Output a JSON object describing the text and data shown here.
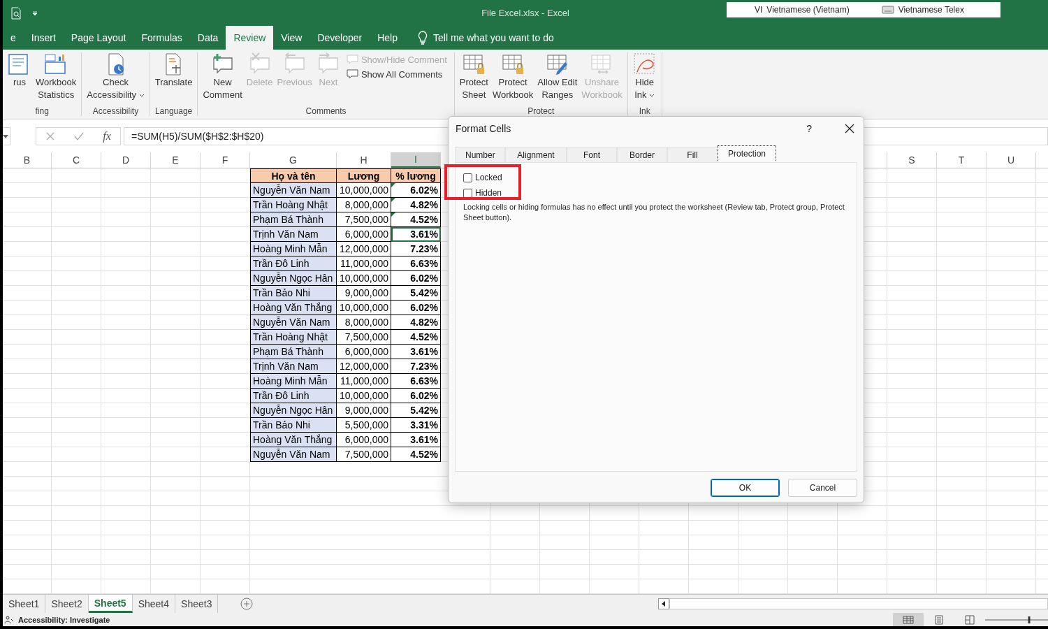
{
  "window": {
    "title": "File Excel.xlsx  -  Excel"
  },
  "language_bar": {
    "code": "VI",
    "language": "Vietnamese (Vietnam)",
    "keyboard": "Vietnamese Telex"
  },
  "tabs": [
    {
      "label": "e",
      "selected": false
    },
    {
      "label": "Insert",
      "selected": false
    },
    {
      "label": "Page Layout",
      "selected": false
    },
    {
      "label": "Formulas",
      "selected": false
    },
    {
      "label": "Data",
      "selected": false
    },
    {
      "label": "Review",
      "selected": true
    },
    {
      "label": "View",
      "selected": false
    },
    {
      "label": "Developer",
      "selected": false
    },
    {
      "label": "Help",
      "selected": false
    }
  ],
  "tell_me": {
    "placeholder": "Tell me what you want to do"
  },
  "ribbon": {
    "groups": [
      {
        "label": "fing",
        "buttons": [
          {
            "kind": "large",
            "lines": [
              "rus"
            ],
            "disabled": false,
            "dropdown": false
          },
          {
            "kind": "large",
            "lines": [
              "Workbook",
              "Statistics"
            ],
            "disabled": false,
            "dropdown": false
          }
        ]
      },
      {
        "label": "Accessibility",
        "buttons": [
          {
            "kind": "large",
            "lines": [
              "Check",
              "Accessibility"
            ],
            "disabled": false,
            "dropdown": true
          }
        ]
      },
      {
        "label": "Language",
        "buttons": [
          {
            "kind": "large",
            "lines": [
              "Translate"
            ],
            "disabled": false,
            "dropdown": false
          }
        ]
      },
      {
        "label": "Comments",
        "buttons": [
          {
            "kind": "large",
            "lines": [
              "New",
              "Comment"
            ],
            "disabled": false,
            "dropdown": false
          },
          {
            "kind": "large",
            "lines": [
              "Delete"
            ],
            "disabled": true,
            "dropdown": false
          },
          {
            "kind": "large",
            "lines": [
              "Previous"
            ],
            "disabled": true,
            "dropdown": false
          },
          {
            "kind": "large",
            "lines": [
              "Next"
            ],
            "disabled": true,
            "dropdown": false
          },
          {
            "kind": "small",
            "lines": [
              "Show/Hide Comment"
            ],
            "disabled": true
          },
          {
            "kind": "small",
            "lines": [
              "Show All Comments"
            ],
            "disabled": false
          }
        ]
      },
      {
        "label": "Protect",
        "buttons": [
          {
            "kind": "large",
            "lines": [
              "Protect",
              "Sheet"
            ],
            "disabled": false,
            "dropdown": false
          },
          {
            "kind": "large",
            "lines": [
              "Protect",
              "Workbook"
            ],
            "disabled": false,
            "dropdown": false
          },
          {
            "kind": "large",
            "lines": [
              "Allow Edit",
              "Ranges"
            ],
            "disabled": false,
            "dropdown": false
          },
          {
            "kind": "large",
            "lines": [
              "Unshare",
              "Workbook"
            ],
            "disabled": true,
            "dropdown": false
          }
        ]
      },
      {
        "label": "Ink",
        "buttons": [
          {
            "kind": "large",
            "lines": [
              "Hide",
              "Ink"
            ],
            "disabled": false,
            "dropdown": true
          }
        ]
      }
    ]
  },
  "formula_bar": {
    "function_label": "fx",
    "formula": "=SUM(H5)/SUM($H$2:$H$20)"
  },
  "columns": [
    {
      "letter": "B",
      "selected": false
    },
    {
      "letter": "C",
      "selected": false
    },
    {
      "letter": "D",
      "selected": false
    },
    {
      "letter": "E",
      "selected": false
    },
    {
      "letter": "F",
      "selected": false
    },
    {
      "letter": "G",
      "selected": false
    },
    {
      "letter": "H",
      "selected": false
    },
    {
      "letter": "I",
      "selected": true
    },
    {
      "letter": "S",
      "selected": false
    },
    {
      "letter": "T",
      "selected": false
    },
    {
      "letter": "U",
      "selected": false
    }
  ],
  "table": {
    "columns": [
      "Họ và tên",
      "Lương",
      "% lương"
    ],
    "rows": [
      {
        "name": "Nguyễn Văn Nam",
        "salary": "10,000,000",
        "percent": "6.02%",
        "flagged": true,
        "selected": false
      },
      {
        "name": "Trần Hoàng Nhật",
        "salary": "8,000,000",
        "percent": "4.82%",
        "flagged": true,
        "selected": false
      },
      {
        "name": "Phạm Bá Thành",
        "salary": "7,500,000",
        "percent": "4.52%",
        "flagged": true,
        "selected": false
      },
      {
        "name": "Trịnh Văn Nam",
        "salary": "6,000,000",
        "percent": "3.61%",
        "flagged": false,
        "selected": true
      },
      {
        "name": "Hoàng Minh Mẫn",
        "salary": "12,000,000",
        "percent": "7.23%",
        "flagged": false,
        "selected": false
      },
      {
        "name": "Trần Đô Linh",
        "salary": "11,000,000",
        "percent": "6.63%",
        "flagged": false,
        "selected": false
      },
      {
        "name": "Nguyễn Ngọc Hân",
        "salary": "10,000,000",
        "percent": "6.02%",
        "flagged": false,
        "selected": false
      },
      {
        "name": "Trần Bảo Nhi",
        "salary": "9,000,000",
        "percent": "5.42%",
        "flagged": false,
        "selected": false
      },
      {
        "name": "Hoàng Văn Thắng",
        "salary": "10,000,000",
        "percent": "6.02%",
        "flagged": false,
        "selected": false
      },
      {
        "name": "Nguyễn Văn Nam",
        "salary": "8,000,000",
        "percent": "4.82%",
        "flagged": false,
        "selected": false
      },
      {
        "name": "Trần Hoàng Nhật",
        "salary": "7,500,000",
        "percent": "4.52%",
        "flagged": false,
        "selected": false
      },
      {
        "name": "Phạm Bá Thành",
        "salary": "6,000,000",
        "percent": "3.61%",
        "flagged": false,
        "selected": false
      },
      {
        "name": "Trịnh Văn Nam",
        "salary": "12,000,000",
        "percent": "7.23%",
        "flagged": false,
        "selected": false
      },
      {
        "name": "Hoàng Minh Mẫn",
        "salary": "11,000,000",
        "percent": "6.63%",
        "flagged": false,
        "selected": false
      },
      {
        "name": "Trần Đô Linh",
        "salary": "10,000,000",
        "percent": "6.02%",
        "flagged": false,
        "selected": false
      },
      {
        "name": "Nguyễn Ngọc Hân",
        "salary": "9,000,000",
        "percent": "5.42%",
        "flagged": false,
        "selected": false
      },
      {
        "name": "Trần Bảo Nhi",
        "salary": "5,500,000",
        "percent": "3.31%",
        "flagged": false,
        "selected": false
      },
      {
        "name": "Hoàng Văn Thắng",
        "salary": "6,000,000",
        "percent": "3.61%",
        "flagged": false,
        "selected": false
      },
      {
        "name": "Nguyễn Văn Nam",
        "salary": "7,500,000",
        "percent": "4.52%",
        "flagged": false,
        "selected": false
      }
    ]
  },
  "sheet_tabs": [
    {
      "label": "Sheet1",
      "selected": false
    },
    {
      "label": "Sheet2",
      "selected": false
    },
    {
      "label": "Sheet5",
      "selected": true
    },
    {
      "label": "Sheet4",
      "selected": false
    },
    {
      "label": "Sheet3",
      "selected": false
    }
  ],
  "status_bar": {
    "text": "Accessibility: Investigate",
    "zoom_slider": {
      "level": 0.7
    }
  },
  "dialog": {
    "title": "Format Cells",
    "help": "?",
    "tabs": [
      {
        "label": "Number",
        "selected": false
      },
      {
        "label": "Alignment",
        "selected": false
      },
      {
        "label": "Font",
        "selected": false
      },
      {
        "label": "Border",
        "selected": false
      },
      {
        "label": "Fill",
        "selected": false
      },
      {
        "label": "Protection",
        "selected": true
      }
    ],
    "options": [
      {
        "label": "Locked",
        "checked": false
      },
      {
        "label": "Hidden",
        "checked": false
      }
    ],
    "note": "Locking cells or hiding formulas has no effect until you protect the worksheet (Review tab, Protect group, Protect Sheet button).",
    "buttons": [
      {
        "label": "OK",
        "default": true
      },
      {
        "label": "Cancel",
        "default": false
      }
    ]
  }
}
